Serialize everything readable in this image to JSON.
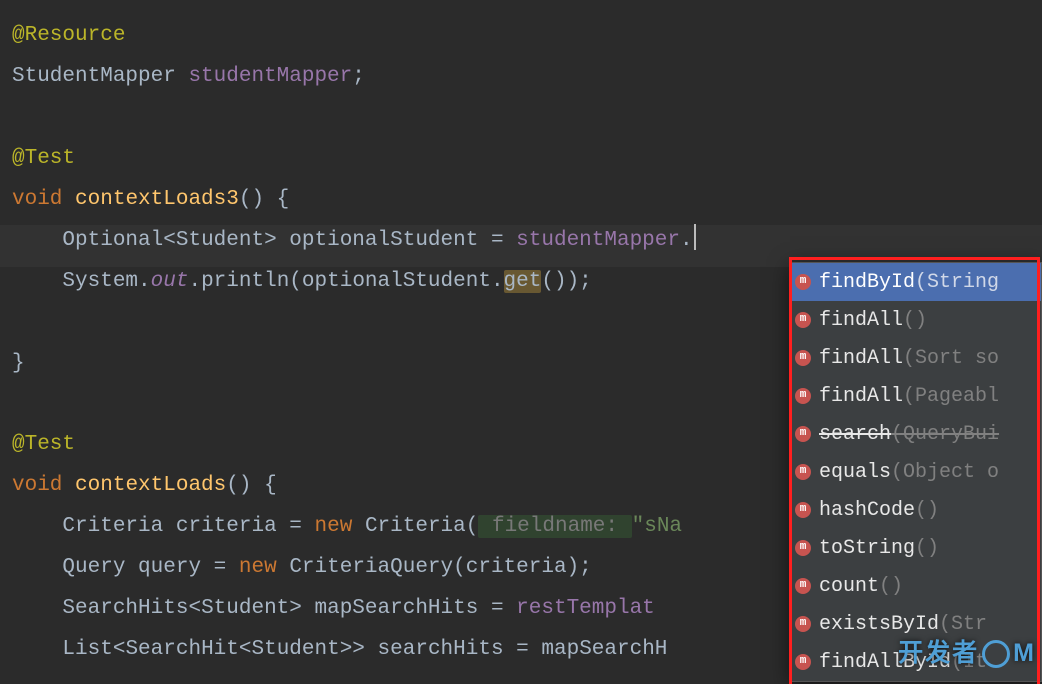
{
  "code": {
    "anno_resource": "@Resource",
    "type_studentmapper": "StudentMapper",
    "field_studentmapper": "studentMapper",
    "anno_test": "@Test",
    "kw_void": "void",
    "fn_contextloads3": "contextLoads3",
    "fn_contextloads": "contextLoads",
    "type_optional": "Optional",
    "type_student": "Student",
    "var_optionalstudent": "optionalStudent",
    "ref_studentmapper": "studentMapper",
    "type_system": "System",
    "field_out": "out",
    "fn_println": "println",
    "fn_get": "get",
    "type_criteria": "Criteria",
    "var_criteria": "criteria",
    "kw_new": "new",
    "hint_fieldname": " fieldname: ",
    "str_sna": "\"sNa",
    "type_query": "Query",
    "var_query": "query",
    "type_criteriaquery": "CriteriaQuery",
    "type_searchhits": "SearchHits",
    "var_mapsearchhits": "mapSearchHits",
    "ref_resttemplate": "restTemplat",
    "type_list": "List",
    "type_searchhit": "SearchHit",
    "var_searchhits": "searchHits",
    "ref_mapsearch": "mapSearchH"
  },
  "popup": {
    "items": [
      {
        "name": "findById",
        "params": "(String",
        "strike": false,
        "sel": true
      },
      {
        "name": "findAll",
        "params": "()",
        "strike": false,
        "sel": false
      },
      {
        "name": "findAll",
        "params": "(Sort so",
        "strike": false,
        "sel": false
      },
      {
        "name": "findAll",
        "params": "(Pageabl",
        "strike": false,
        "sel": false
      },
      {
        "name": "search",
        "params": "(QueryBui",
        "strike": true,
        "sel": false
      },
      {
        "name": "equals",
        "params": "(Object o",
        "strike": false,
        "sel": false
      },
      {
        "name": "hashCode",
        "params": "()",
        "strike": false,
        "sel": false
      },
      {
        "name": "toString",
        "params": "()",
        "strike": false,
        "sel": false
      },
      {
        "name": "count",
        "params": "()",
        "strike": false,
        "sel": false
      },
      {
        "name": "existsById",
        "params": "(Str",
        "strike": false,
        "sel": false
      },
      {
        "name": "findAllById",
        "params": "(It",
        "strike": false,
        "sel": false
      }
    ]
  },
  "watermark": {
    "prefix": "开发者",
    "suffix": "M"
  }
}
